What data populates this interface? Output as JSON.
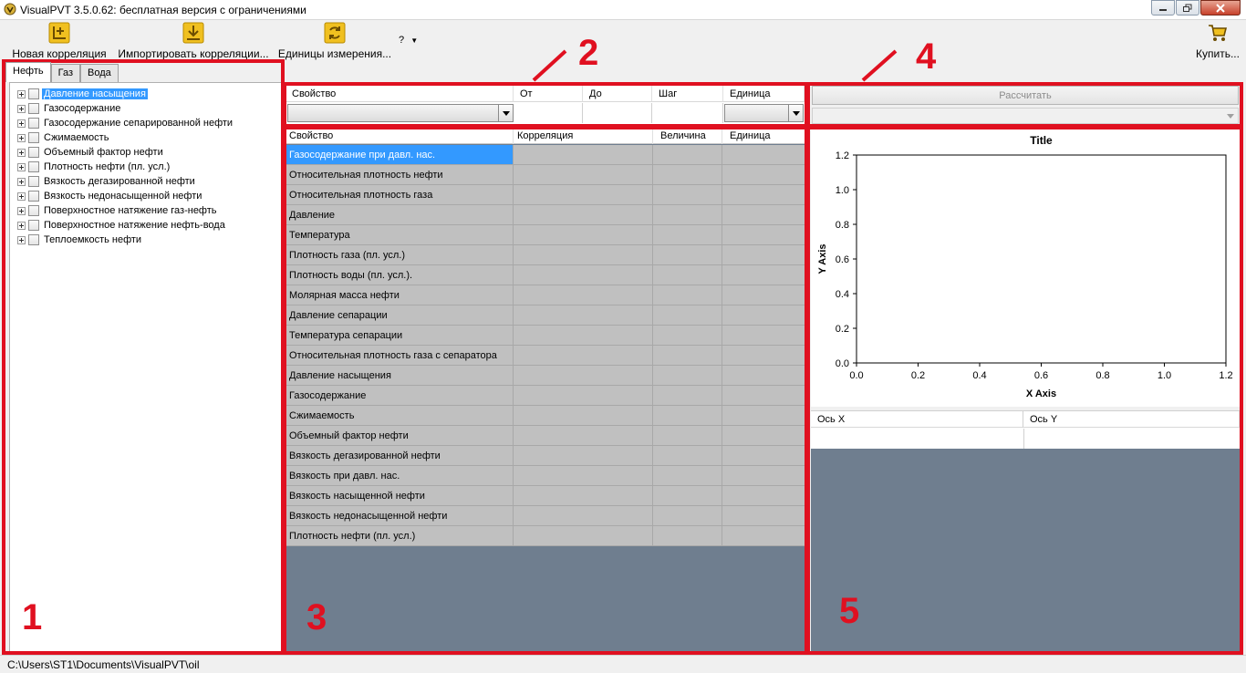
{
  "window": {
    "title": "VisualPVT 3.5.0.62: бесплатная версия с ограничениями"
  },
  "toolbar": {
    "new_correlation": "Новая корреляция",
    "import_correlation": "Импортировать корреляции...",
    "units": "Единицы измерения...",
    "help": "?",
    "buy": "Купить..."
  },
  "annotations": [
    "1",
    "2",
    "3",
    "4",
    "5"
  ],
  "tabs": [
    "Нефть",
    "Газ",
    "Вода"
  ],
  "tree": [
    "Давление насыщения",
    "Газосодержание",
    "Газосодержание сепарированной нефти",
    "Сжимаемость",
    "Объемный фактор нефти",
    "Плотность нефти (пл. усл.)",
    "Вязкость дегазированной нефти",
    "Вязкость недонасыщенной нефти",
    "Поверхностное натяжение газ-нефть",
    "Поверхностное натяжение нефть-вода",
    "Теплоемкость нефти"
  ],
  "input_grid": {
    "headers": [
      "Свойство",
      "От",
      "До",
      "Шаг",
      "Единица"
    ]
  },
  "correlation_table": {
    "headers": [
      "Свойство",
      "Корреляция",
      "Величина",
      "Единица"
    ],
    "rows": [
      "Газосодержание при давл. нас.",
      "Относительная плотность нефти",
      "Относительная плотность газа",
      "Давление",
      "Температура",
      "Плотность газа (пл. усл.)",
      "Плотность воды (пл. усл.).",
      "Молярная масса нефти",
      "Давление сепарации",
      "Температура сепарации",
      "Относительная плотность газа с сепаратора",
      "Давление насыщения",
      "Газосодержание",
      "Сжимаемость",
      "Объемный фактор нефти",
      "Вязкость дегазированной нефти",
      "Вязкость при давл. нас.",
      "Вязкость насыщенной нефти",
      "Вязкость недонасыщенной нефти",
      "Плотность нефти (пл. усл.)"
    ]
  },
  "calc": {
    "button": "Рассчитать"
  },
  "axis_table": {
    "headers": [
      "Ось X",
      "Ось Y"
    ]
  },
  "chart_data": {
    "type": "line",
    "title": "Title",
    "xlabel": "X Axis",
    "ylabel": "Y Axis",
    "xlim": [
      0,
      1.2
    ],
    "ylim": [
      0,
      1.2
    ],
    "xticks": [
      "0.0",
      "0.2",
      "0.4",
      "0.6",
      "0.8",
      "1.0",
      "1.2"
    ],
    "yticks": [
      "0.0",
      "0.2",
      "0.4",
      "0.6",
      "0.8",
      "1.0",
      "1.2"
    ],
    "series": []
  },
  "status": {
    "path": "C:\\Users\\ST1\\Documents\\VisualPVT\\oil"
  },
  "colors": {
    "annotation": "#e01020",
    "selection": "#3399ff",
    "panel_bg": "#6f7e8f"
  }
}
